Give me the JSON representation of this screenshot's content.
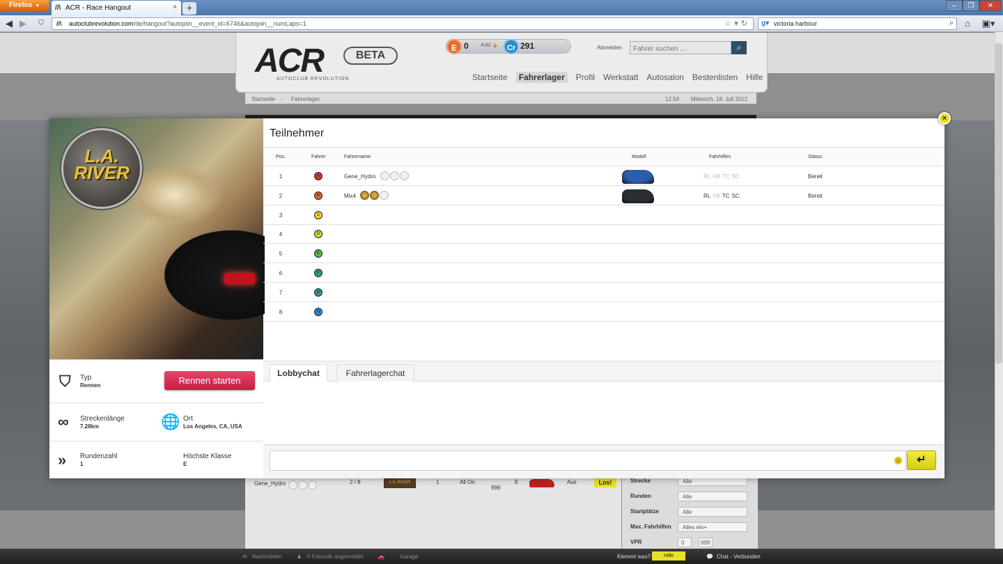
{
  "browser": {
    "app_button": "Firefox",
    "tab_title": "ACR - Race Hangout",
    "url_host": "autoclubrevolution.com",
    "url_path": "/de/hangout?autojoin__event_id=6746&autojoin__numLaps=1",
    "search_value": "victoria harbour"
  },
  "site": {
    "logo": "ACR",
    "logo_sub": "AUTOCLUB REVOLUTION",
    "beta": "BETA",
    "e_coin": "E",
    "e_value": "0",
    "add_label": "Add",
    "cr_coin": "Cr",
    "cr_value": "291",
    "logout": "Abmelden",
    "search_placeholder": "Fahrer suchen ...",
    "nav": [
      "Startseite",
      "Fahrerlager",
      "Profil",
      "Werkstatt",
      "Autosalon",
      "Bestenlisten",
      "Hilfe"
    ],
    "nav_active": "Fahrerlager",
    "breadcrumb": [
      "Startseite",
      "Fahrerlager"
    ],
    "time": "12:54",
    "date": "Mittwoch, 18. Juli 2012"
  },
  "background_list": {
    "row": {
      "driver": "Gene_Hydro",
      "slots": "2 / 8",
      "thumb": "L.A. RIVER",
      "laps": "1",
      "aids": "All On",
      "number": "999",
      "class": "E",
      "status": "Aus",
      "action": "Los!"
    },
    "filters": [
      {
        "label": "Strecke",
        "value": "Alle"
      },
      {
        "label": "Runden",
        "value": "Alle"
      },
      {
        "label": "Startplätze",
        "value": "Alle"
      },
      {
        "label": "Max. Fahrhilfen",
        "value": "Alles ein+"
      },
      {
        "label": "VPR",
        "value": "0",
        "value2": "999"
      }
    ]
  },
  "statusbar": {
    "messages": "Nachrichten",
    "friends": "0 Freunde angemeldet",
    "garage": "Garage",
    "stuck": "Klemmt was?",
    "help": "Hilfe",
    "chat": "Chat - Verbunden"
  },
  "modal": {
    "close": "×",
    "track_name": "L.A. RIVER",
    "panel_title": "Teilnehmer",
    "columns": {
      "pos": "Pos.",
      "driver": "Fahrer",
      "driver_name": "Fahrername",
      "model": "Modell",
      "aids": "Fahrhilfen",
      "status": "Status"
    },
    "participants": [
      {
        "pos": "1",
        "letter": "A",
        "color": "#d8322a",
        "name": "Gene_Hydro",
        "has_car": true,
        "car_color": "#2b5da8",
        "aids": [
          "RL",
          "AB",
          "TC",
          "SC"
        ],
        "aids_on": [
          false,
          false,
          false,
          false
        ],
        "status": "Bereit",
        "badges": 3,
        "filled_badges": 0
      },
      {
        "pos": "2",
        "letter": "B",
        "color": "#e0622a",
        "name": "Mix4",
        "has_car": true,
        "car_color": "#2a2d33",
        "aids": [
          "RL",
          "AB",
          "TC",
          "SC"
        ],
        "aids_on": [
          true,
          false,
          true,
          true
        ],
        "status": "Bereit",
        "badges": 3,
        "filled_badges": 2
      },
      {
        "pos": "3",
        "letter": "C",
        "color": "#f1d436",
        "name": "",
        "has_car": false,
        "aids": [],
        "status": "",
        "badges": 0
      },
      {
        "pos": "4",
        "letter": "D",
        "color": "#c8d93a",
        "name": "",
        "has_car": false,
        "aids": [],
        "status": "",
        "badges": 0
      },
      {
        "pos": "5",
        "letter": "E",
        "color": "#5cb84a",
        "name": "",
        "has_car": false,
        "aids": [],
        "status": "",
        "badges": 0
      },
      {
        "pos": "6",
        "letter": "F",
        "color": "#2fa06a",
        "name": "",
        "has_car": false,
        "aids": [],
        "status": "",
        "badges": 0
      },
      {
        "pos": "7",
        "letter": "G",
        "color": "#2a9a9a",
        "name": "",
        "has_car": false,
        "aids": [],
        "status": "",
        "badges": 0
      },
      {
        "pos": "8",
        "letter": "H",
        "color": "#2a8ad0",
        "name": "",
        "has_car": false,
        "aids": [],
        "status": "",
        "badges": 0
      }
    ],
    "info": {
      "type_label": "Typ",
      "type_value": "Rennen",
      "start_button": "Rennen starten",
      "length_label": "Streckenlänge",
      "length_value": "7.28km",
      "location_label": "Ort",
      "location_value": "Los Angeles, CA, USA",
      "laps_label": "Rundenzahl",
      "laps_value": "1",
      "class_label": "Höchste Klasse",
      "class_value": "E"
    },
    "chat": {
      "tab_lobby": "Lobbychat",
      "tab_camp": "Fahrerlagerchat",
      "input_value": "",
      "send": "↵",
      "smiley": "☺"
    }
  }
}
